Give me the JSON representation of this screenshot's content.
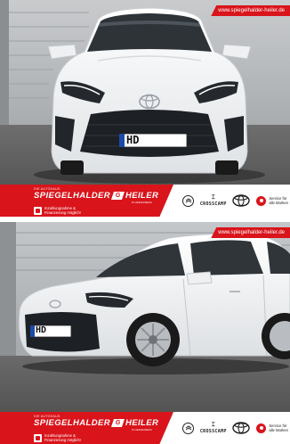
{
  "photos": [
    {
      "id": "front",
      "url_banner": "www.spiegelhalder-heiler.de",
      "plate_text": "HD",
      "footer": {
        "brand_small": "DIE AUTOHAUS",
        "brand_left": "SPIEGELHALDER",
        "brand_logo": "G",
        "brand_right": "HEILER",
        "brand_sub": "IN HEIDELBERG",
        "finance_line1": "Inzahlungnahme &",
        "finance_line2": "Finanzierung möglich!",
        "crosscamp": "CROSSCAMP",
        "service_line1": "Service für",
        "service_line2": "alle Marken"
      }
    },
    {
      "id": "side",
      "url_banner": "www.spiegelhalder-heiler.de",
      "plate_text": "HD",
      "footer": {
        "brand_small": "DIE AUTOHAUS",
        "brand_left": "SPIEGELHALDER",
        "brand_logo": "G",
        "brand_right": "HEILER",
        "brand_sub": "IN HEIDELBERG",
        "finance_line1": "Inzahlungnahme &",
        "finance_line2": "Finanzierung möglich!",
        "crosscamp": "CROSSCAMP",
        "service_line1": "Service für",
        "service_line2": "alle Marken"
      }
    }
  ],
  "colors": {
    "brand_red": "#d9141b",
    "car_white": "#f4f5f6",
    "showroom_wall": "#b9bcbf"
  }
}
